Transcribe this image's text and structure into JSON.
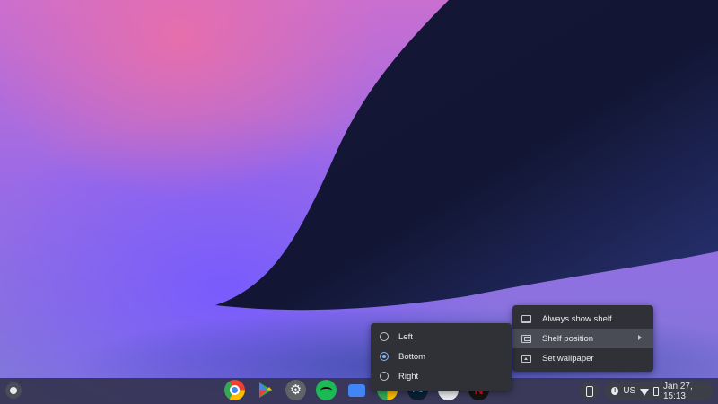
{
  "shelf": {
    "launcher_icon": "launcher-icon",
    "apps": [
      "chrome-icon",
      "play-store-icon",
      "settings-icon",
      "spotify-icon",
      "files-icon",
      "photos-icon",
      "photoshop-icon",
      "google-photos-icon",
      "netflix-icon"
    ]
  },
  "status": {
    "keyboard_layout": "US",
    "datetime": "Jan 27, 15:13"
  },
  "context_menu": {
    "items": [
      {
        "label": "Always show shelf",
        "icon": "shelf-icon"
      },
      {
        "label": "Shelf position",
        "icon": "shelf-position-icon",
        "has_submenu": true,
        "active": true
      },
      {
        "label": "Set wallpaper",
        "icon": "wallpaper-icon"
      }
    ]
  },
  "submenu": {
    "items": [
      {
        "label": "Left",
        "selected": false
      },
      {
        "label": "Bottom",
        "selected": true
      },
      {
        "label": "Right",
        "selected": false
      }
    ]
  },
  "colors": {
    "accent": "#8ab4f8",
    "menu_bg": "#2f3136"
  }
}
